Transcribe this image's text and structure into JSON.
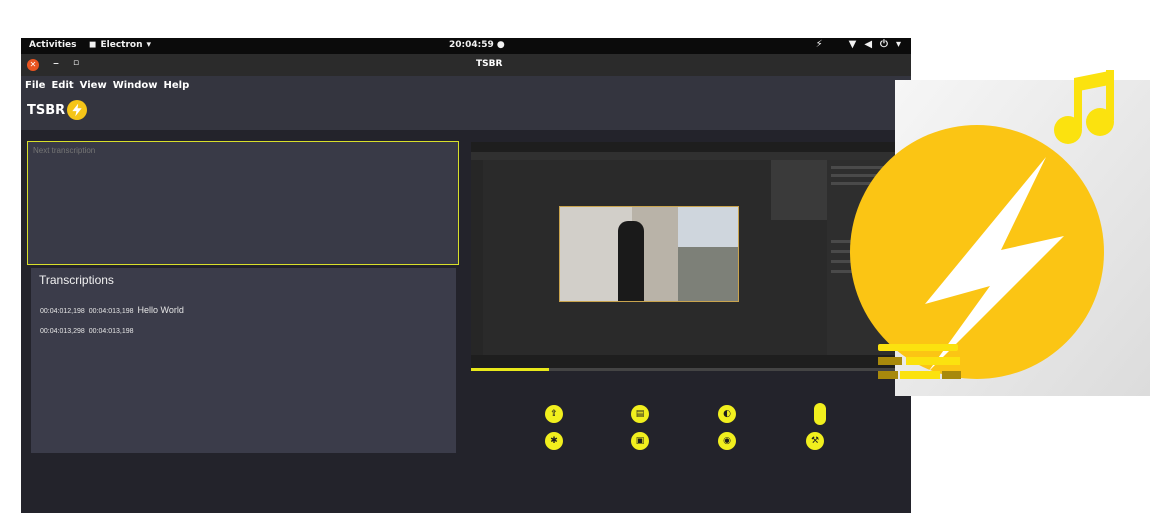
{
  "system_bar": {
    "activities": "Activities",
    "app_name": "Electron",
    "clock": "20:04:59"
  },
  "window": {
    "title": "TSBR"
  },
  "menu": [
    "File",
    "Edit",
    "View",
    "Window",
    "Help"
  ],
  "brand": "TSBR",
  "next_transcription": {
    "placeholder": "Next transcription"
  },
  "transcriptions": {
    "title": "Transcriptions",
    "rows": [
      {
        "start": "00:04:012,198",
        "end": "00:04:013,198",
        "text": "Hello World"
      },
      {
        "start": "00:04:013,298",
        "end": "00:04:013,198",
        "text": ""
      }
    ]
  },
  "video": {
    "progress": 0.18
  },
  "controls": [
    {
      "icon": "upload-icon"
    },
    {
      "icon": "file-icon"
    },
    {
      "icon": "contrast-icon"
    },
    {
      "icon": "toggle-icon"
    },
    {
      "icon": "settings-icon"
    },
    {
      "icon": "save-icon"
    },
    {
      "icon": "eye-icon"
    },
    {
      "icon": "hammer-icon"
    }
  ],
  "colors": {
    "accent": "#f1ef1e",
    "logo": "#f5c518"
  }
}
